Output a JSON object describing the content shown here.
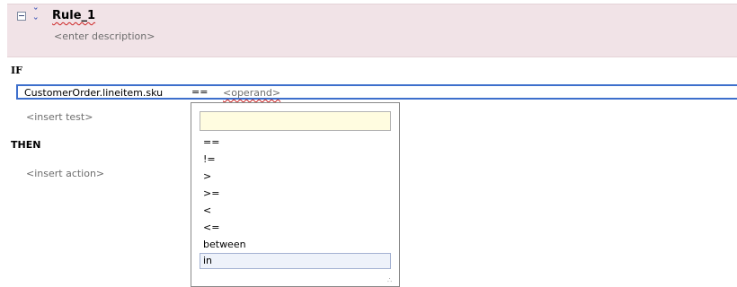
{
  "rule": {
    "title": "Rule_1",
    "description_placeholder": "<enter description>",
    "collapse_icon": "minus-box-icon",
    "expand_icon": "double-chevron-icon"
  },
  "condition": {
    "if_label": "IF",
    "left_operand": "CustomerOrder.lineitem.sku",
    "operator": "==",
    "right_operand_placeholder": "<operand>",
    "insert_test": "<insert test>"
  },
  "action": {
    "then_label": "THEN",
    "insert_action": "<insert action>"
  },
  "operator_menu": {
    "filter_value": "",
    "options": [
      "==",
      "!=",
      ">",
      ">=",
      "<",
      "<=",
      "between",
      "in"
    ],
    "selected": "in"
  },
  "colors": {
    "header_bg": "#f1e3e7",
    "focus_border": "#3d6fcc",
    "filter_bg": "#fffce0",
    "selected_bg": "#eef2fa"
  }
}
